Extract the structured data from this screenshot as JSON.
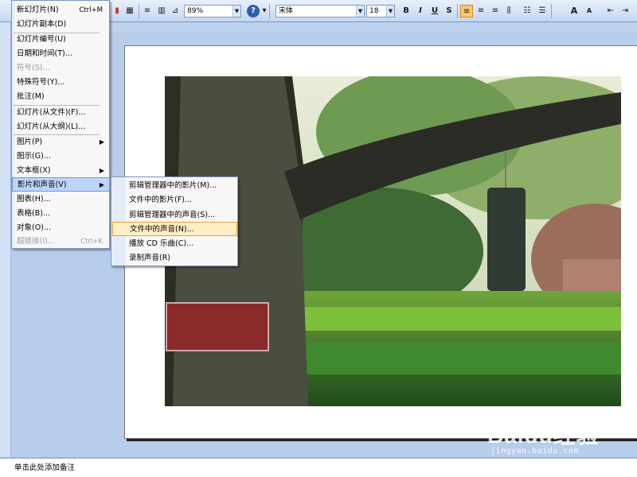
{
  "toolbar": {
    "zoom_value": "89%",
    "font_name": "宋体",
    "font_size": "18",
    "bold": "B",
    "italic": "I",
    "underline": "U",
    "shadow": "S",
    "grow_font": "A",
    "shrink_font": "A"
  },
  "insert_menu": {
    "items": [
      {
        "label": "新幻灯片(N)",
        "shortcut": "Ctrl+M"
      },
      {
        "label": "幻灯片副本(D)"
      },
      {
        "label": "幻灯片编号(U)"
      },
      {
        "label": "日期和时间(T)..."
      },
      {
        "label": "符号(S)..."
      },
      {
        "label": "特殊符号(Y)..."
      },
      {
        "label": "批注(M)"
      },
      {
        "label": "幻灯片(从文件)(F)..."
      },
      {
        "label": "幻灯片(从大纲)(L)..."
      },
      {
        "label": "图片(P)"
      },
      {
        "label": "图示(G)..."
      },
      {
        "label": "文本框(X)"
      },
      {
        "label": "影片和声音(V)"
      },
      {
        "label": "图表(H)..."
      },
      {
        "label": "表格(B)..."
      },
      {
        "label": "对象(O)..."
      },
      {
        "label": "超链接(I)...",
        "shortcut": "Ctrl+K"
      }
    ]
  },
  "media_menu": {
    "items": [
      {
        "label": "剪辑管理器中的影片(M)..."
      },
      {
        "label": "文件中的影片(F)..."
      },
      {
        "label": "剪辑管理器中的声音(S)..."
      },
      {
        "label": "文件中的声音(N)..."
      },
      {
        "label": "播放 CD 乐曲(C)..."
      },
      {
        "label": "录制声音(R)"
      }
    ]
  },
  "notes": {
    "placeholder": "单击此处添加备注"
  },
  "watermark": {
    "logo": "Baidu经验",
    "url": "jingyan.baidu.com"
  }
}
